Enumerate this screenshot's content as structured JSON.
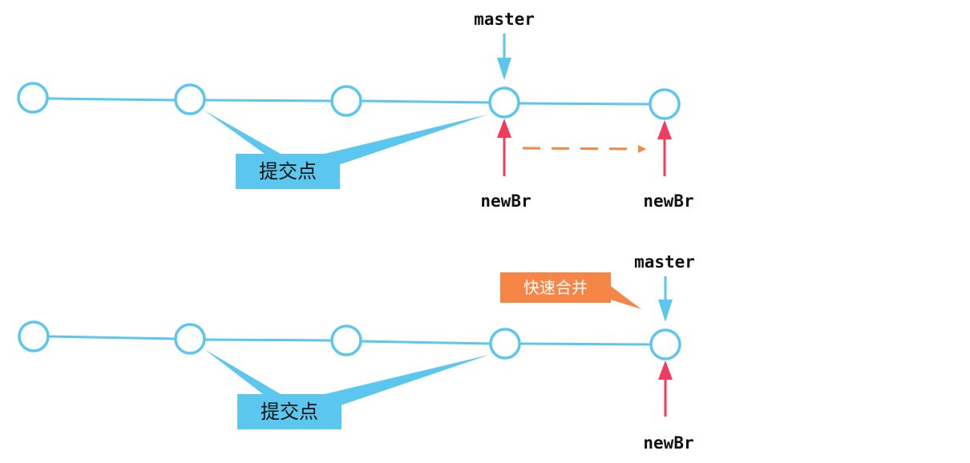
{
  "colors": {
    "line": "#5bc6ee",
    "node_stroke": "#5bc6ee",
    "node_fill": "#ffffff",
    "master_arrow": "#5bc6ee",
    "newbr_arrow": "#f23b5e",
    "move_arrow": "#f58646",
    "callout_fill": "#5bc6ee",
    "merge_fill": "#f58646"
  },
  "top": {
    "master_label": "master",
    "newbr_label_old": "newBr",
    "newbr_label_new": "newBr",
    "callout_label": "提交点"
  },
  "bottom": {
    "master_label": "master",
    "newbr_label": "newBr",
    "callout_label": "提交点",
    "merge_label": "快速合并"
  }
}
